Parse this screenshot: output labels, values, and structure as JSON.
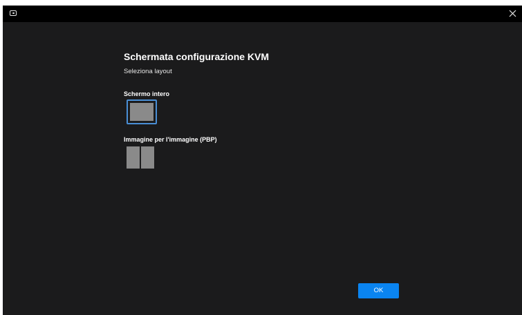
{
  "titlebar": {
    "app_icon": "monitor-icon",
    "close_icon": "close-icon"
  },
  "dialog": {
    "title": "Schermata configurazione KVM",
    "subtitle": "Seleziona layout"
  },
  "layouts": [
    {
      "label": "Schermo intero",
      "selected": true,
      "panes": 1
    },
    {
      "label": "Immagine per l'immagine (PBP)",
      "selected": false,
      "panes": 2
    }
  ],
  "buttons": {
    "ok_label": "OK"
  },
  "colors": {
    "background": "#1b1b1c",
    "titlebar": "#000000",
    "accent": "#0a84f0",
    "selection_border": "#4a8fd6",
    "pane": "#8a8a8a"
  }
}
